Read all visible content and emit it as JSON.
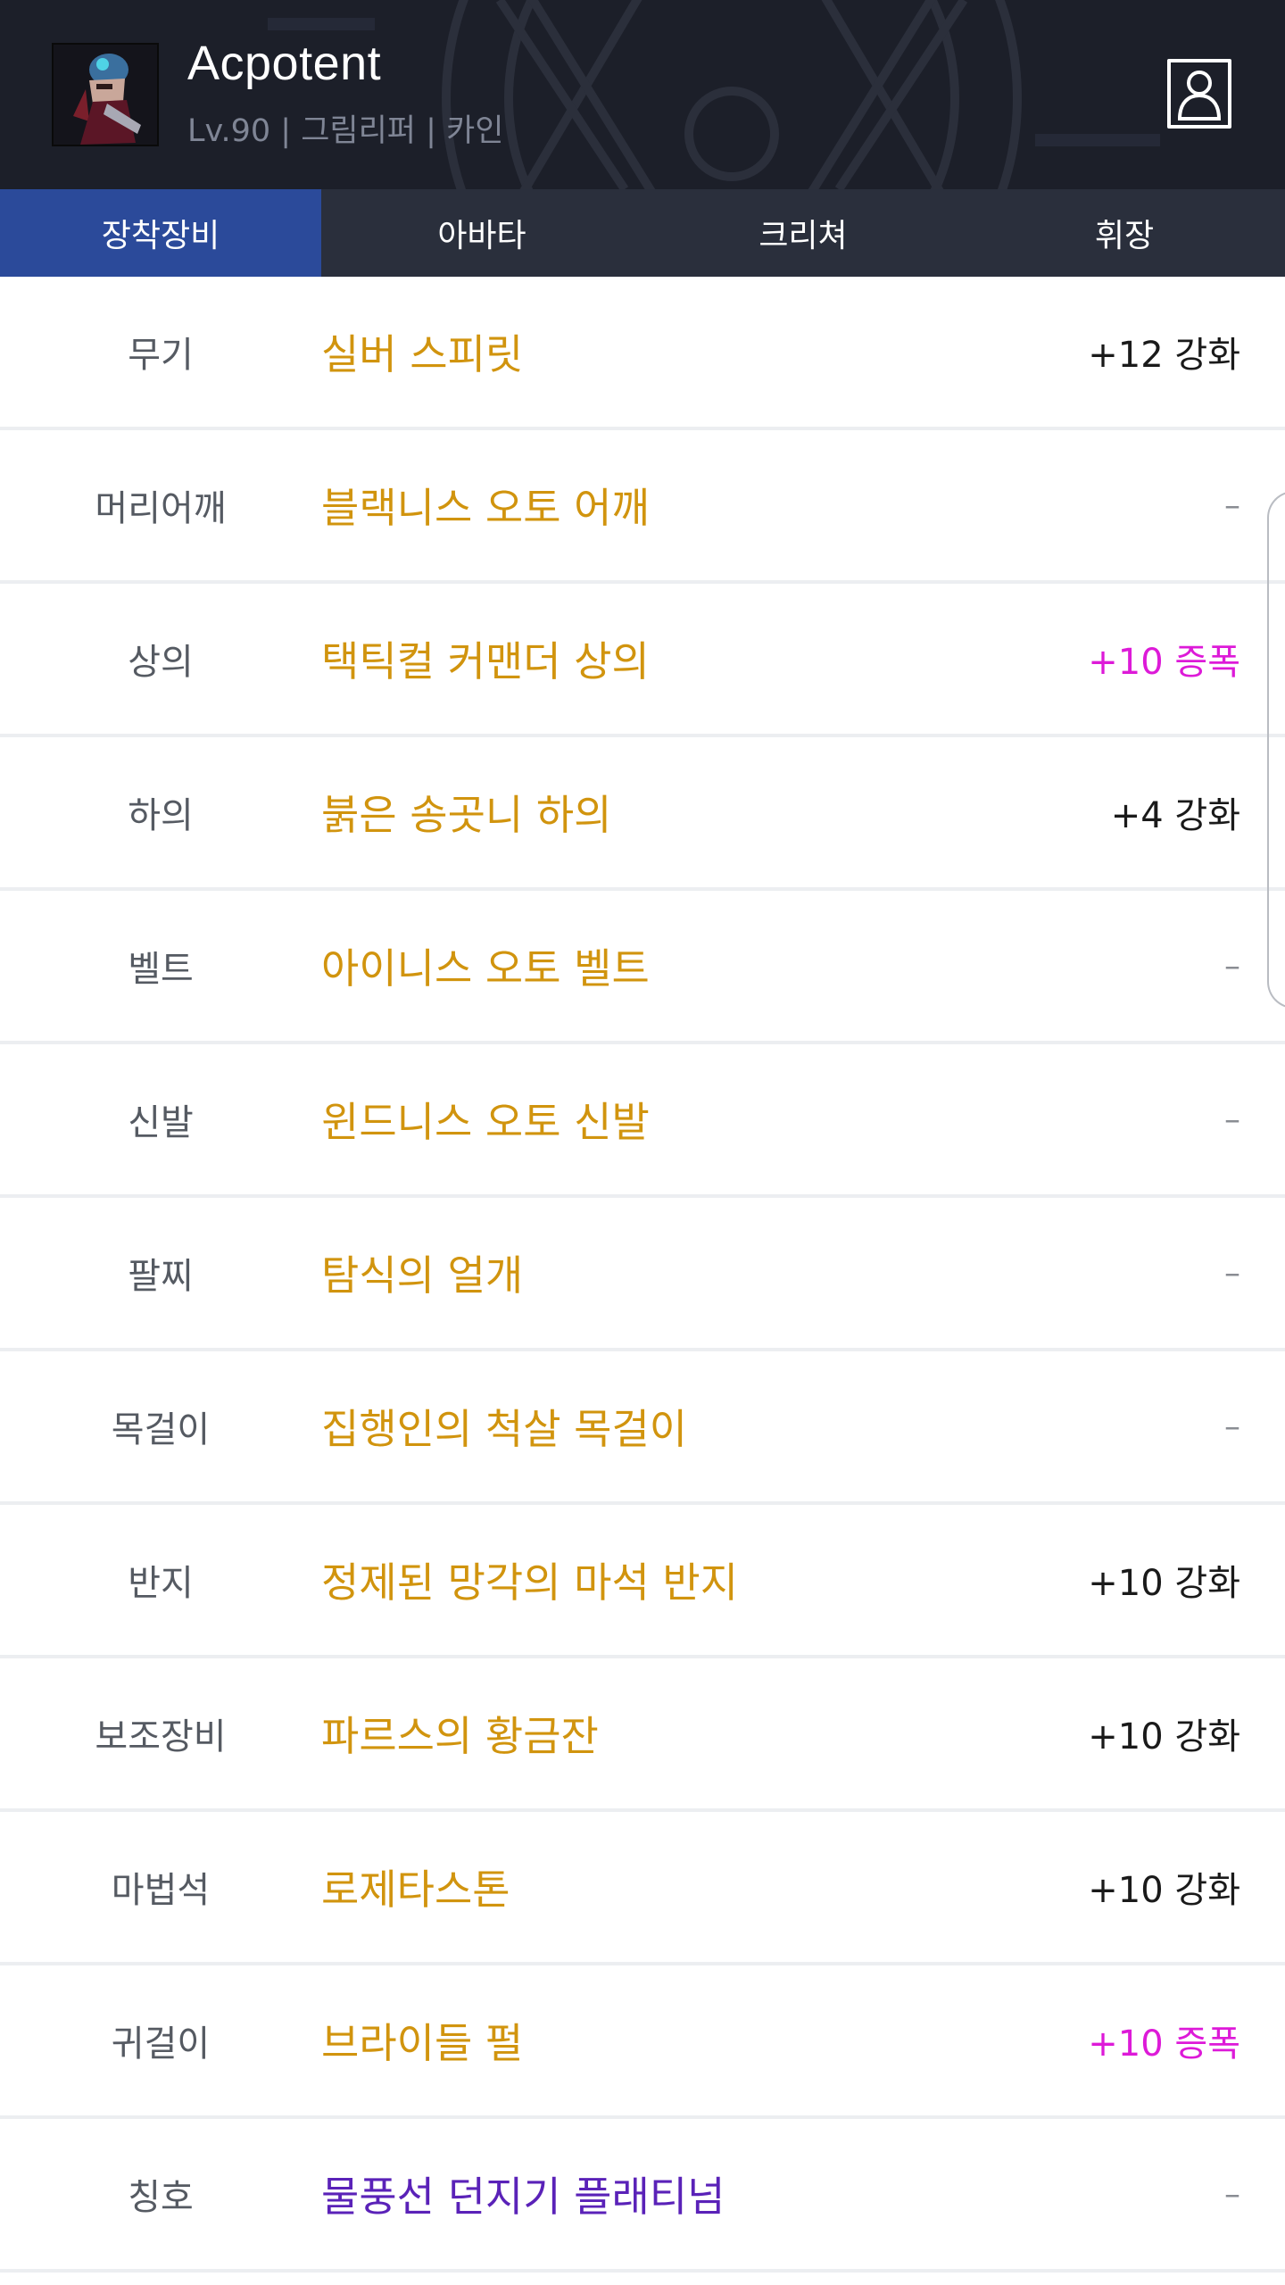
{
  "header": {
    "character_name": "Acpotent",
    "character_info": "Lv.90 | 그림리퍼 | 카인",
    "avatar_icon": "character-avatar",
    "profile_icon": "profile-icon"
  },
  "tabs": [
    {
      "label": "장착장비",
      "active": true
    },
    {
      "label": "아바타",
      "active": false
    },
    {
      "label": "크리쳐",
      "active": false
    },
    {
      "label": "휘장",
      "active": false
    }
  ],
  "equipment": [
    {
      "slot": "무기",
      "item": "실버 스피릿",
      "upgrade": "+12 강화",
      "upgrade_type": "reinforce"
    },
    {
      "slot": "머리어깨",
      "item": "블랙니스 오토 어깨",
      "upgrade": "–",
      "upgrade_type": "none"
    },
    {
      "slot": "상의",
      "item": "택틱컬 커맨더 상의",
      "upgrade": "+10 증폭",
      "upgrade_type": "amplify"
    },
    {
      "slot": "하의",
      "item": "붉은 송곳니 하의",
      "upgrade": "+4 강화",
      "upgrade_type": "reinforce"
    },
    {
      "slot": "벨트",
      "item": "아이니스 오토 벨트",
      "upgrade": "–",
      "upgrade_type": "none"
    },
    {
      "slot": "신발",
      "item": "윈드니스 오토 신발",
      "upgrade": "–",
      "upgrade_type": "none"
    },
    {
      "slot": "팔찌",
      "item": "탐식의 얼개",
      "upgrade": "–",
      "upgrade_type": "none"
    },
    {
      "slot": "목걸이",
      "item": "집행인의 척살 목걸이",
      "upgrade": "–",
      "upgrade_type": "none"
    },
    {
      "slot": "반지",
      "item": "정제된 망각의 마석 반지",
      "upgrade": "+10 강화",
      "upgrade_type": "reinforce"
    },
    {
      "slot": "보조장비",
      "item": "파르스의 황금잔",
      "upgrade": "+10 강화",
      "upgrade_type": "reinforce"
    },
    {
      "slot": "마법석",
      "item": "로제타스톤",
      "upgrade": "+10 강화",
      "upgrade_type": "reinforce"
    },
    {
      "slot": "귀걸이",
      "item": "브라이들 펄",
      "upgrade": "+10 증폭",
      "upgrade_type": "amplify"
    },
    {
      "slot": "칭호",
      "item": "물풍선 던지기 플래티넘",
      "upgrade": "–",
      "upgrade_type": "none",
      "item_color": "title"
    }
  ],
  "colors": {
    "header_bg": "#1c1f29",
    "tab_bar_bg": "#2a2f3c",
    "tab_active_bg": "#2b4a9a",
    "item_name": "#d1940e",
    "title_item_name": "#5a22b8",
    "amplify_text": "#dd1ad8"
  }
}
